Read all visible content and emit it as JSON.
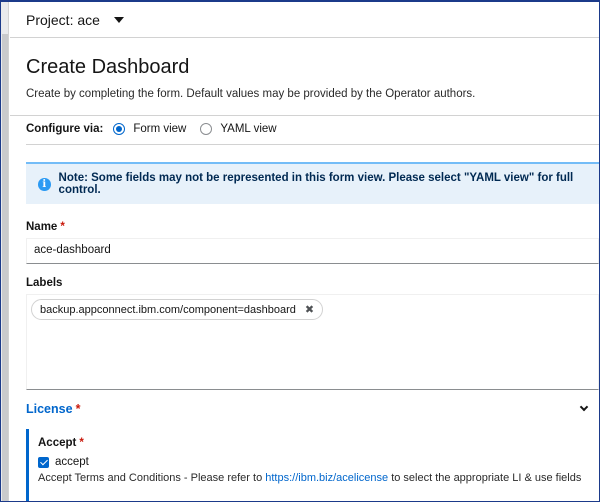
{
  "project": {
    "label": "Project: ace"
  },
  "header": {
    "title": "Create Dashboard",
    "description": "Create by completing the form. Default values may be provided by the Operator authors."
  },
  "configure": {
    "label": "Configure via:",
    "options": [
      {
        "label": "Form view",
        "selected": true
      },
      {
        "label": "YAML view",
        "selected": false
      }
    ]
  },
  "alert": {
    "text": "Note: Some fields may not be represented in this form view. Please select \"YAML view\" for full control."
  },
  "name_field": {
    "label": "Name",
    "required_mark": "*",
    "value": "ace-dashboard"
  },
  "labels_field": {
    "label": "Labels",
    "chips": [
      "backup.appconnect.ibm.com/component=dashboard"
    ],
    "remove_glyph": "✖"
  },
  "license": {
    "title": "License",
    "required_mark": "*",
    "accept_label": "Accept",
    "checkbox_label": "accept",
    "checked": true,
    "helper_prefix": "Accept Terms and Conditions - Please refer to ",
    "helper_link": "https://ibm.biz/acelicense",
    "helper_suffix": " to select the appropriate LI & use fields"
  }
}
